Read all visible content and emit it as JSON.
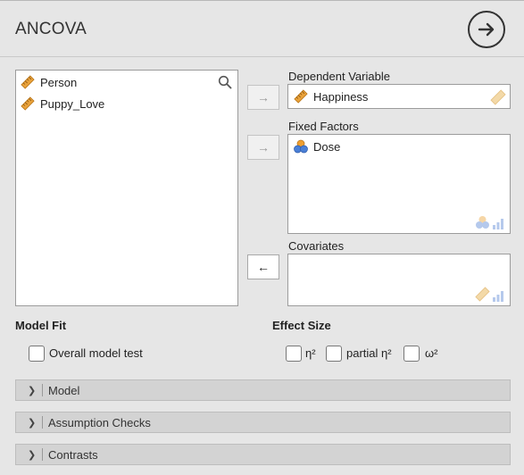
{
  "header": {
    "title": "ANCOVA"
  },
  "source_vars": [
    {
      "name": "Person",
      "icon": "ruler-scale-icon"
    },
    {
      "name": "Puppy_Love",
      "icon": "ruler-scale-icon"
    }
  ],
  "dependent": {
    "label": "Dependent Variable",
    "value": "Happiness"
  },
  "fixed_factors": {
    "label": "Fixed Factors",
    "items": [
      "Dose"
    ]
  },
  "covariates": {
    "label": "Covariates"
  },
  "model_fit": {
    "label": "Model Fit",
    "overall_label": "Overall model test"
  },
  "effect_size": {
    "label": "Effect Size",
    "eta2": "η²",
    "partial_eta2": "partial η²",
    "omega2": "ω²"
  },
  "sections": [
    {
      "label": "Model"
    },
    {
      "label": "Assumption Checks"
    },
    {
      "label": "Contrasts"
    }
  ],
  "arrows": {
    "right": "→",
    "left": "←"
  },
  "colors": {
    "scale": "#e9a23b",
    "scale_faded": "#f3d9a8",
    "nominal_blue": "#4a7fd6",
    "nominal_orange": "#f0a030"
  }
}
